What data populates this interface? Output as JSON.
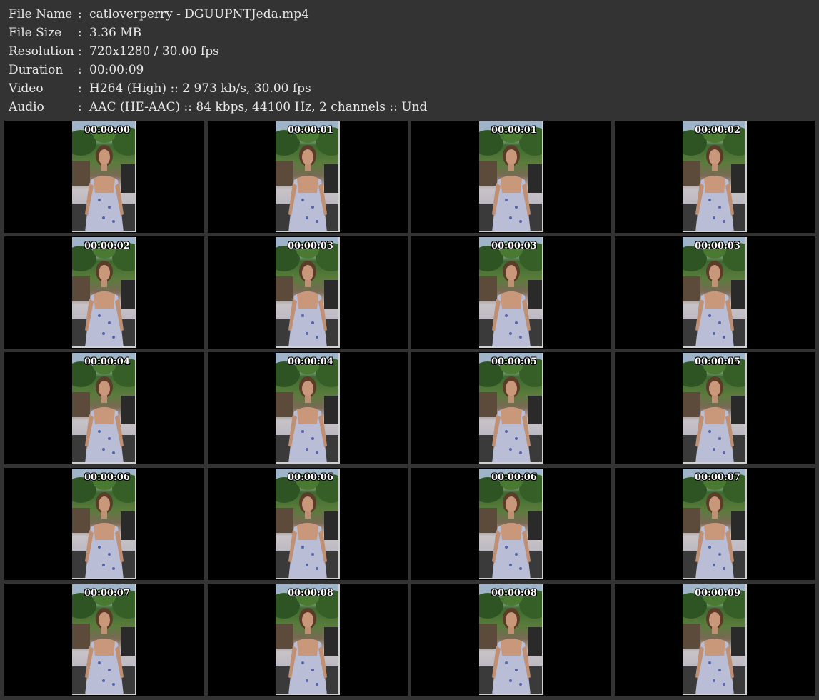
{
  "info": [
    {
      "label": "File Name",
      "sep": ":",
      "value": "catloverperry - DGUUPNTJeda.mp4"
    },
    {
      "label": "File Size",
      "sep": ":",
      "value": "3.36 MB"
    },
    {
      "label": "Resolution",
      "sep": ":",
      "value": "720x1280 / 30.00 fps"
    },
    {
      "label": "Duration",
      "sep": ":",
      "value": "00:00:09"
    },
    {
      "label": "Video",
      "sep": ":",
      "value": "H264 (High) :: 2 973 kb/s, 30.00 fps"
    },
    {
      "label": "Audio",
      "sep": ":",
      "value": "AAC (HE-AAC) :: 84 kbps, 44100 Hz, 2 channels :: Und"
    }
  ],
  "thumbnails": [
    {
      "timestamp": "00:00:00"
    },
    {
      "timestamp": "00:00:01"
    },
    {
      "timestamp": "00:00:01"
    },
    {
      "timestamp": "00:00:02"
    },
    {
      "timestamp": "00:00:02"
    },
    {
      "timestamp": "00:00:03"
    },
    {
      "timestamp": "00:00:03"
    },
    {
      "timestamp": "00:00:03"
    },
    {
      "timestamp": "00:00:04"
    },
    {
      "timestamp": "00:00:04"
    },
    {
      "timestamp": "00:00:05"
    },
    {
      "timestamp": "00:00:05"
    },
    {
      "timestamp": "00:00:06"
    },
    {
      "timestamp": "00:00:06"
    },
    {
      "timestamp": "00:00:06"
    },
    {
      "timestamp": "00:00:07"
    },
    {
      "timestamp": "00:00:07"
    },
    {
      "timestamp": "00:00:08"
    },
    {
      "timestamp": "00:00:08"
    },
    {
      "timestamp": "00:00:09"
    }
  ],
  "colors": {
    "background": "#333333",
    "text": "#e8e8e8",
    "cell": "#000000",
    "frame_border": "#d0d0d0"
  }
}
